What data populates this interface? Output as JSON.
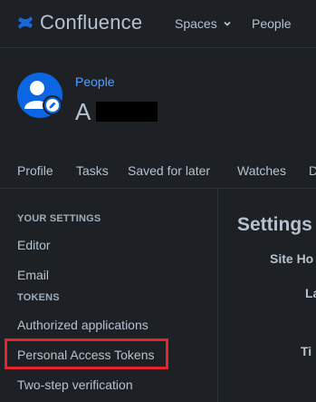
{
  "header": {
    "app_name": "Confluence",
    "nav": {
      "spaces": "Spaces",
      "people": "People"
    }
  },
  "profile": {
    "breadcrumb": "People",
    "name": "A"
  },
  "tabs": [
    "Profile",
    "Tasks",
    "Saved for later",
    "Watches",
    "D"
  ],
  "sidebar": {
    "your_settings_heading": "YOUR SETTINGS",
    "your_settings_items": [
      "Editor",
      "Email"
    ],
    "tokens_heading": "TOKENS",
    "tokens_items": [
      "Authorized applications",
      "Personal Access Tokens",
      "Two-step verification"
    ]
  },
  "main": {
    "title": "Settings",
    "labels": [
      "Site Ho",
      "La",
      "Ti"
    ]
  },
  "colors": {
    "background": "#1d2125",
    "link": "#579dff",
    "brand": "#1868db",
    "highlight": "#e2262b"
  }
}
